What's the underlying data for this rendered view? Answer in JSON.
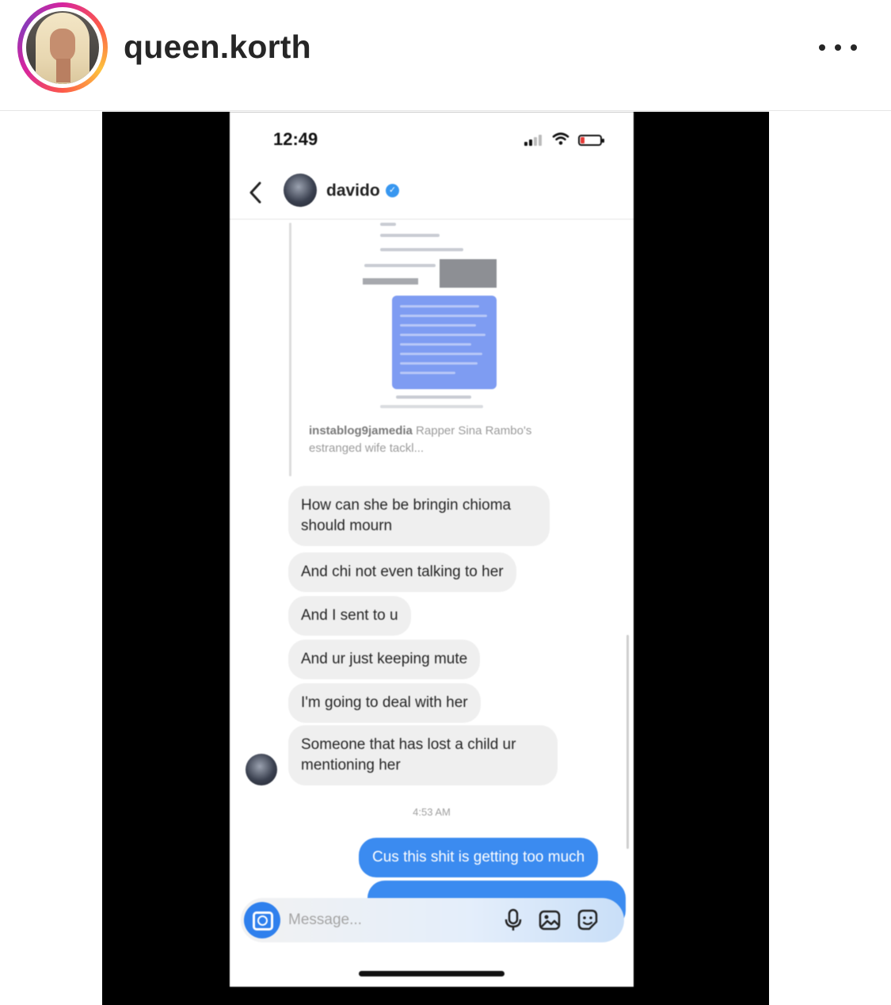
{
  "post": {
    "username": "queen.korth",
    "more_icon": "more-horizontal-icon",
    "avatar_icon": "profile-avatar"
  },
  "screenshot": {
    "status": {
      "time": "12:49"
    },
    "chat": {
      "contact_name": "davido",
      "verified": true,
      "verified_glyph": "✓",
      "shared_post": {
        "account": "instablog9jamedia",
        "caption": "Rapper Sina Rambo's estranged wife tackl..."
      },
      "received_messages": [
        "How can she be bringin chioma should mourn",
        "And chi not even talking to her",
        "And I sent to u",
        "And ur just keeping mute",
        "I'm going to deal with her",
        "Someone that has lost a child ur mentioning her"
      ],
      "timestamp": "4:53 AM",
      "sent_messages": [
        "Cus this shit is getting too much"
      ]
    },
    "composer": {
      "placeholder": "Message...",
      "icons": [
        "camera-icon",
        "microphone-icon",
        "gallery-icon",
        "sticker-icon"
      ]
    }
  }
}
